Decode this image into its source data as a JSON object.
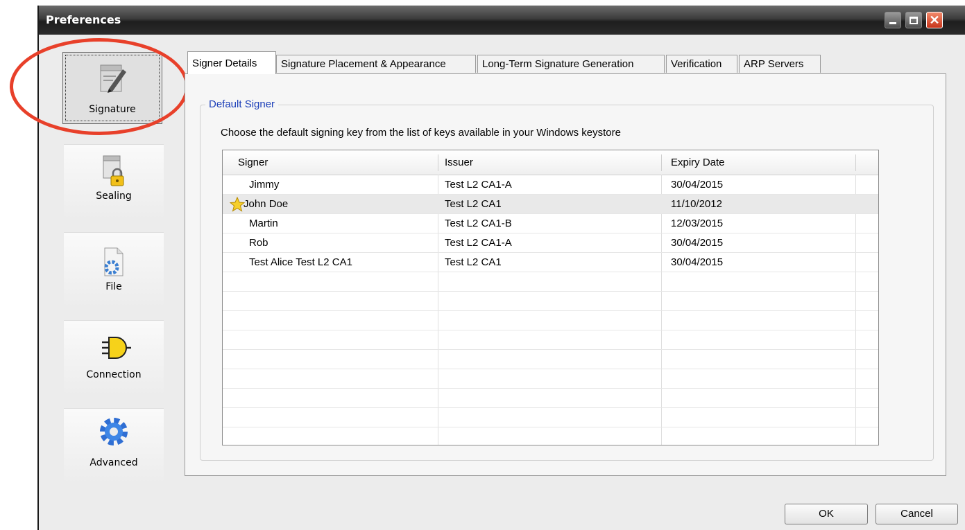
{
  "window": {
    "title": "Preferences"
  },
  "sidebar": {
    "items": [
      {
        "label": "Signature",
        "icon": "signature-pen-icon",
        "selected": true
      },
      {
        "label": "Sealing",
        "icon": "document-lock-icon",
        "selected": false
      },
      {
        "label": "File",
        "icon": "file-gear-icon",
        "selected": false
      },
      {
        "label": "Connection",
        "icon": "plug-connector-icon",
        "selected": false
      },
      {
        "label": "Advanced",
        "icon": "gear-icon",
        "selected": false
      }
    ]
  },
  "tabs": [
    {
      "label": "Signer Details",
      "active": true
    },
    {
      "label": "Signature Placement & Appearance",
      "active": false
    },
    {
      "label": "Long-Term Signature Generation",
      "active": false
    },
    {
      "label": "Verification",
      "active": false
    },
    {
      "label": "ARP Servers",
      "active": false
    }
  ],
  "default_signer": {
    "group_label": "Default Signer",
    "description": "Choose the default signing key from the list of keys available in your Windows keystore",
    "columns": [
      "Signer",
      "Issuer",
      "Expiry Date"
    ],
    "rows": [
      {
        "signer": "Jimmy",
        "issuer": "Test L2 CA1-A",
        "expiry": "30/04/2015",
        "default": false
      },
      {
        "signer": "John Doe",
        "issuer": "Test L2 CA1",
        "expiry": "11/10/2012",
        "default": true
      },
      {
        "signer": "Martin",
        "issuer": "Test L2 CA1-B",
        "expiry": "12/03/2015",
        "default": false
      },
      {
        "signer": "Rob",
        "issuer": "Test L2 CA1-A",
        "expiry": "30/04/2015",
        "default": false
      },
      {
        "signer": "Test Alice Test L2 CA1",
        "issuer": "Test L2 CA1",
        "expiry": "30/04/2015",
        "default": false
      }
    ]
  },
  "buttons": {
    "ok": "OK",
    "cancel": "Cancel"
  },
  "colors": {
    "annotation": "#e8402a",
    "group_label": "#1c3fb8",
    "title_bar": "#2b2b2b"
  }
}
